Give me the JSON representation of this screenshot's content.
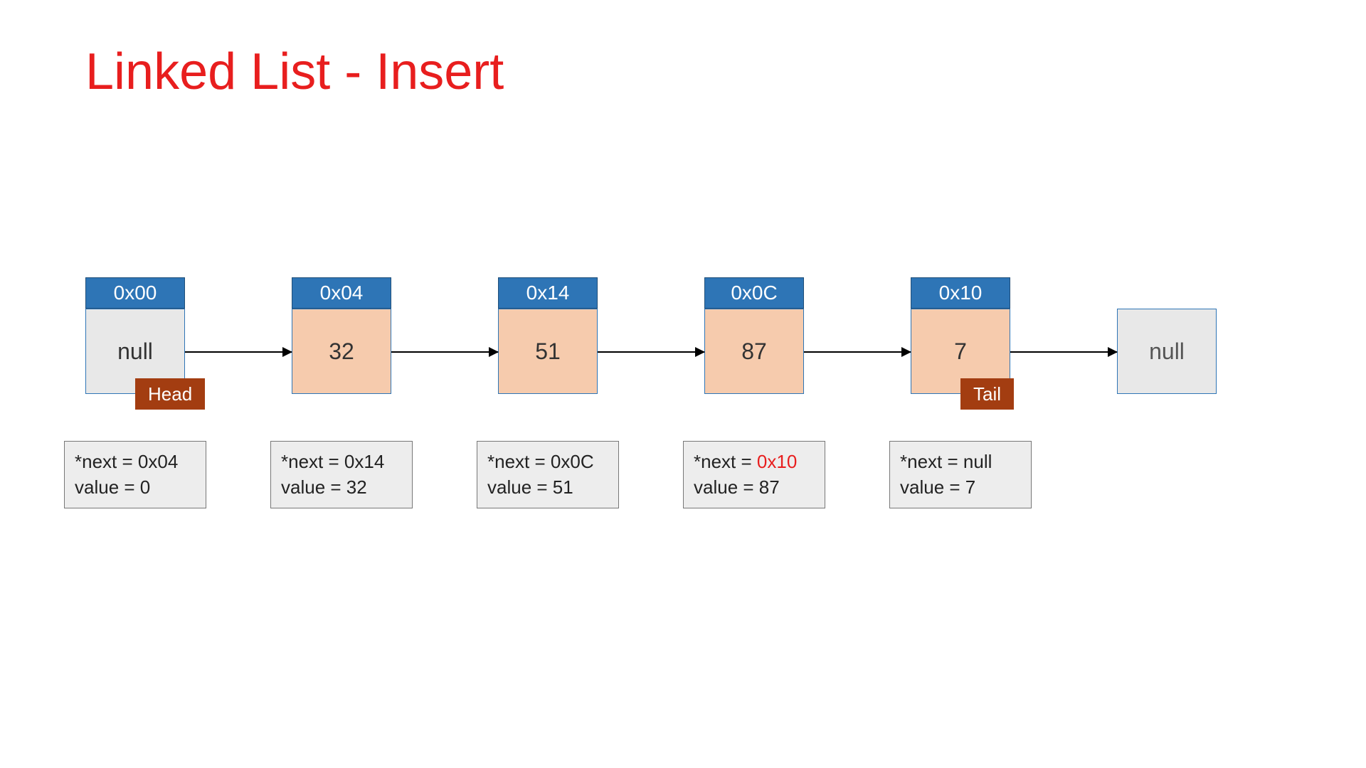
{
  "title": "Linked List - Insert",
  "nodes": [
    {
      "addr": "0x00",
      "val": "null",
      "style": "grey",
      "next_text": "*next = 0x04",
      "value_text": "value = 0"
    },
    {
      "addr": "0x04",
      "val": "32",
      "style": "peach",
      "next_text": "*next = 0x14",
      "value_text": "value = 32"
    },
    {
      "addr": "0x14",
      "val": "51",
      "style": "peach",
      "next_text": "*next = 0x0C",
      "value_text": "value = 51"
    },
    {
      "addr": "0x0C",
      "val": "87",
      "style": "peach",
      "next_prefix": "*next = ",
      "next_suffix": "0x10",
      "value_text": "value = 87",
      "highlight_next": true
    },
    {
      "addr": "0x10",
      "val": "7",
      "style": "peach",
      "next_text": "*next = null",
      "value_text": "value = 7"
    }
  ],
  "tags": {
    "head": "Head",
    "tail": "Tail"
  },
  "null_label": "null"
}
